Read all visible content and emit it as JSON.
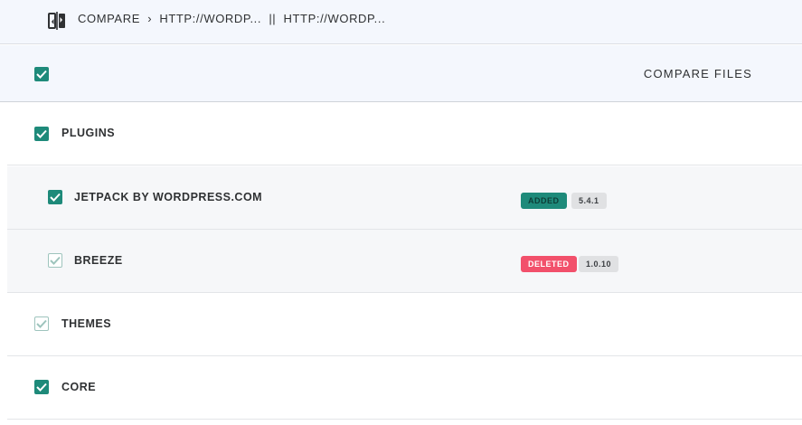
{
  "breadcrumb": {
    "root": "COMPARE",
    "separator": "›",
    "left": "HTTP://WORDP...",
    "divider": "||",
    "right": "HTTP://WORDP..."
  },
  "header": {
    "select_all_checked": true,
    "compare_files_label": "COMPARE FILES"
  },
  "groups": [
    {
      "label": "PLUGINS",
      "checked": true,
      "items": [
        {
          "label": "JETPACK BY WORDPRESS.COM",
          "checked": true,
          "status": "ADDED",
          "version": "5.4.1"
        },
        {
          "label": "BREEZE",
          "checked": "partial",
          "status": "DELETED",
          "version": "1.0.10"
        }
      ]
    },
    {
      "label": "THEMES",
      "checked": "partial"
    },
    {
      "label": "CORE",
      "checked": true
    }
  ],
  "colors": {
    "accent": "#1e8a7a",
    "deleted": "#f2506b",
    "header_bg": "#f4f7fd"
  }
}
